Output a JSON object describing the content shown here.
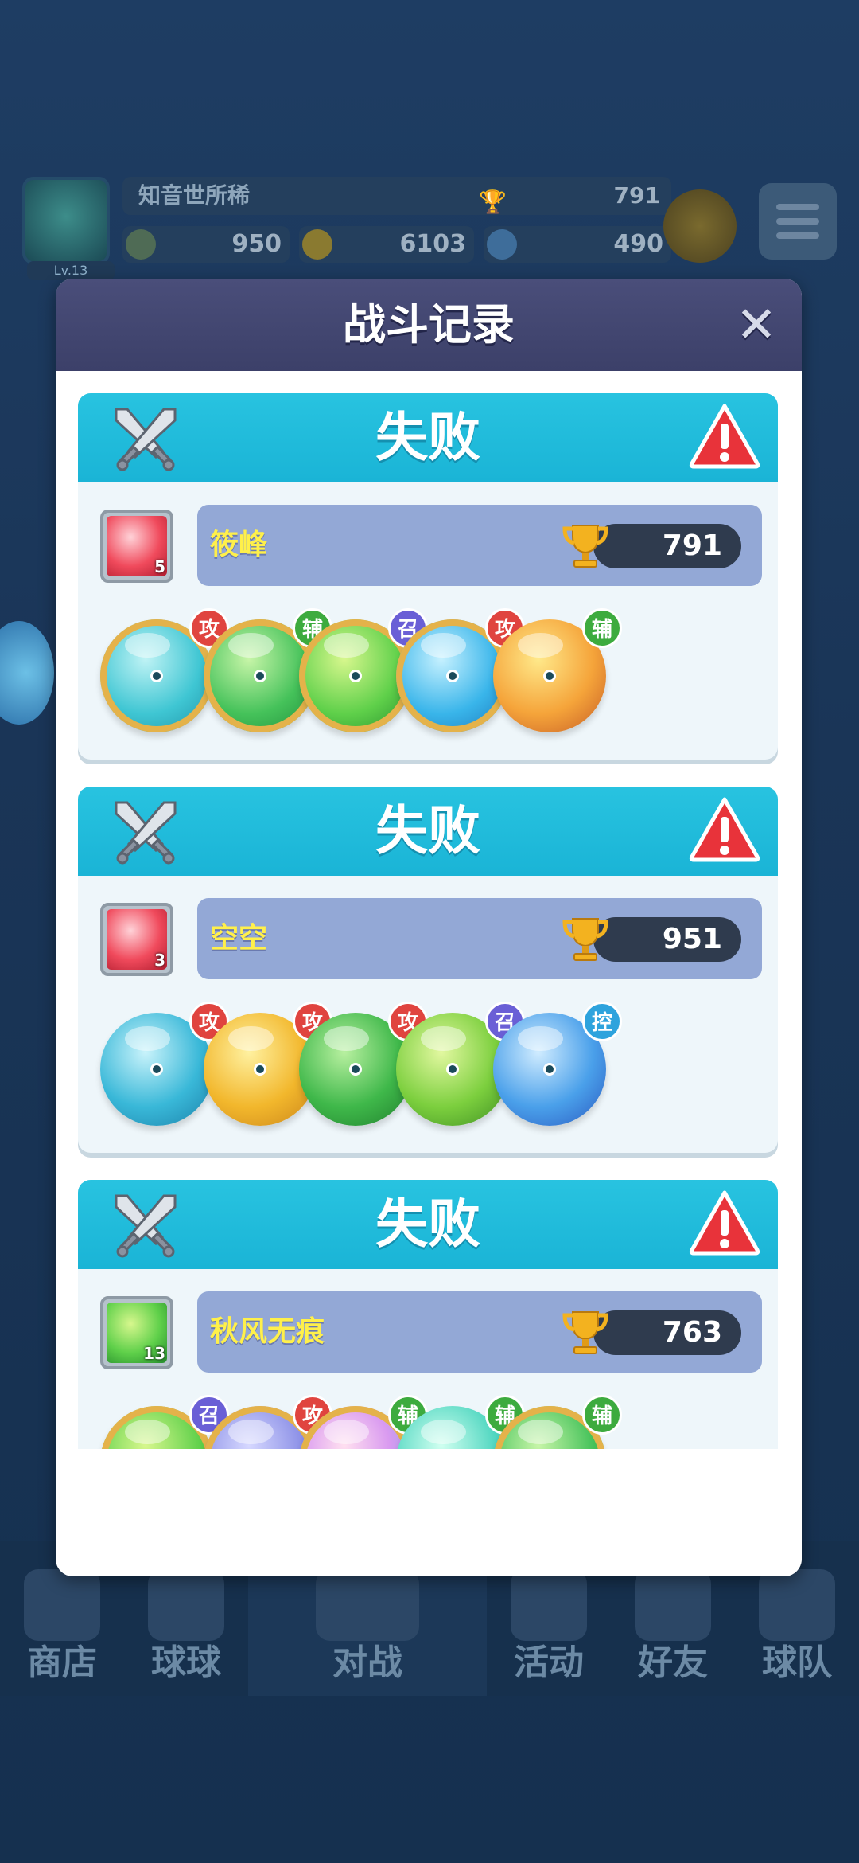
{
  "background": {
    "player": {
      "name": "知音世所稀",
      "level": "Lv.13",
      "trophies": "791"
    },
    "resources": [
      {
        "name": "gold",
        "value": "950"
      },
      {
        "name": "coins",
        "value": "6103"
      },
      {
        "name": "gems",
        "value": "490"
      }
    ],
    "nav": [
      "商店",
      "球球",
      "对战",
      "活动",
      "好友",
      "球队"
    ]
  },
  "modal": {
    "title": "战斗记录",
    "close": "✕"
  },
  "colors": {
    "attack": "#e0443f",
    "support": "#3dab3e",
    "summon": "#6a5fd6",
    "control": "#2ea3dd"
  },
  "records": [
    {
      "result": "失败",
      "player": "筱峰",
      "trophies": "791",
      "lead_level": "5",
      "lead_icon": "fire-ball-icon",
      "balls": [
        {
          "icon": "tornado-ball-icon",
          "role": "攻",
          "role_type": "attack"
        },
        {
          "icon": "star-arrow-ball-icon",
          "role": "辅",
          "role_type": "support"
        },
        {
          "icon": "hexagram-ball-icon",
          "role": "召",
          "role_type": "summon"
        },
        {
          "icon": "ice-blade-ball-icon",
          "role": "攻",
          "role_type": "attack"
        },
        {
          "icon": "pumpkin-ball-icon",
          "role": "辅",
          "role_type": "support"
        }
      ]
    },
    {
      "result": "失败",
      "player": "空空",
      "trophies": "951",
      "lead_level": "3",
      "lead_icon": "fire-ball-icon",
      "balls": [
        {
          "icon": "vortex-ball-icon",
          "role": "攻",
          "role_type": "attack"
        },
        {
          "icon": "lightning-ball-icon",
          "role": "攻",
          "role_type": "attack"
        },
        {
          "icon": "skull-ball-icon",
          "role": "攻",
          "role_type": "attack"
        },
        {
          "icon": "radiation-ball-icon",
          "role": "召",
          "role_type": "summon"
        },
        {
          "icon": "snowflake-ball-icon",
          "role": "控",
          "role_type": "control"
        }
      ]
    },
    {
      "result": "失败",
      "player": "秋风无痕",
      "trophies": "763",
      "lead_level": "13",
      "lead_icon": "hexagram-ball-icon",
      "balls": [
        {
          "icon": "hexagram-ball-icon",
          "role": "召",
          "role_type": "summon"
        },
        {
          "icon": "robot-ball-icon",
          "role": "攻",
          "role_type": "attack"
        },
        {
          "icon": "rainbow-ball-icon",
          "role": "辅",
          "role_type": "support"
        },
        {
          "icon": "sp-ball-icon",
          "role": "辅",
          "role_type": "support"
        },
        {
          "icon": "star-arrow-ball-icon",
          "role": "辅",
          "role_type": "support"
        }
      ]
    }
  ]
}
